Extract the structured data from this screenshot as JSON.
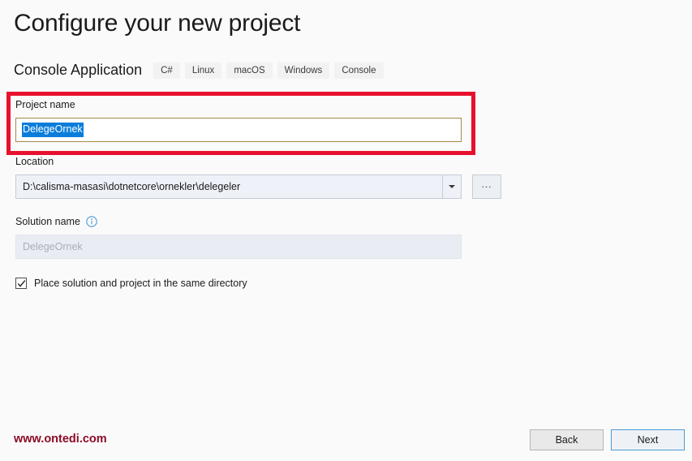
{
  "header": {
    "title": "Configure your new project",
    "template_name": "Console Application",
    "tags": [
      {
        "label": "C#"
      },
      {
        "label": "Linux"
      },
      {
        "label": "macOS"
      },
      {
        "label": "Windows"
      },
      {
        "label": "Console"
      }
    ]
  },
  "form": {
    "project_name": {
      "label": "Project name",
      "value": "DelegeOrnek",
      "selected": true
    },
    "location": {
      "label": "Location",
      "value": "D:\\calisma-masasi\\dotnetcore\\ornekler\\delegeler",
      "browse_label": "...",
      "dropdown_icon": "chevron-down-icon"
    },
    "solution_name": {
      "label": "Solution name",
      "value": "DelegeOrnek",
      "disabled": true,
      "info_icon": "info-icon"
    },
    "same_directory_checkbox": {
      "label": "Place solution and project in the same directory",
      "checked": true
    }
  },
  "annotation": {
    "highlight_color": "#e8112d",
    "target": "project-name-field"
  },
  "footer": {
    "watermark": "www.ontedi.com",
    "watermark_color": "#8c0b26",
    "back_label": "Back",
    "next_label": "Next",
    "next_accent_color": "#4a9ad4"
  }
}
